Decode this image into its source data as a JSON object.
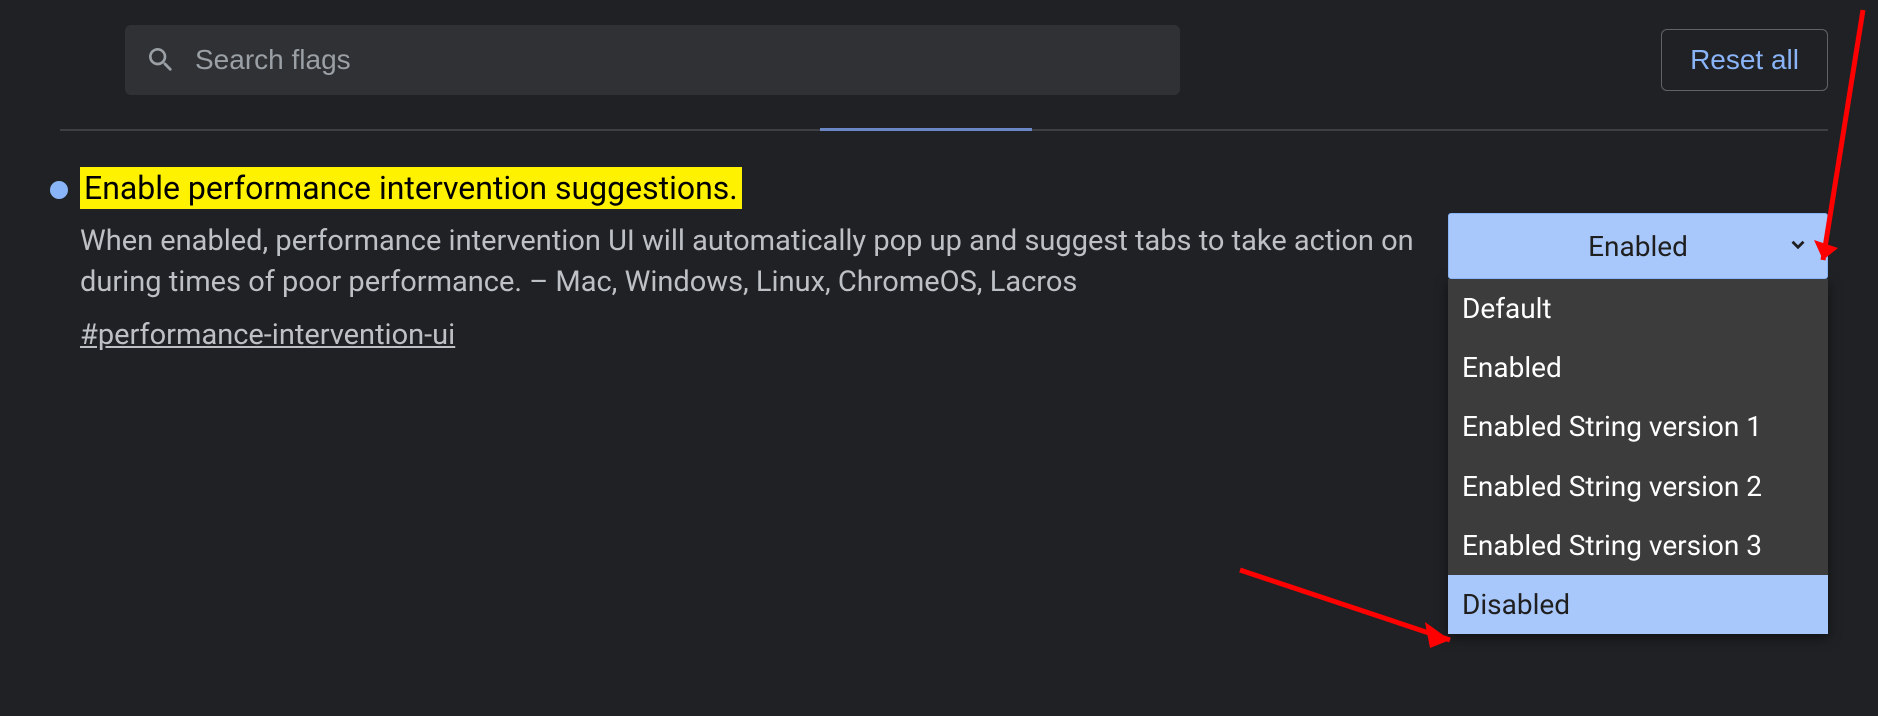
{
  "search": {
    "placeholder": "Search flags"
  },
  "reset_button": {
    "label": "Reset all"
  },
  "flag": {
    "title": "Enable performance intervention suggestions.",
    "description": "When enabled, performance intervention UI will automatically pop up and suggest tabs to take action on during times of poor performance. – Mac, Windows, Linux, ChromeOS, Lacros",
    "id": "#performance-intervention-ui",
    "select": {
      "selected": "Enabled",
      "options": [
        "Default",
        "Enabled",
        "Enabled String version 1",
        "Enabled String version 2",
        "Enabled String version 3",
        "Disabled"
      ],
      "highlighted_index": 5
    }
  },
  "colors": {
    "highlight": "#fff200",
    "accent": "#8ab4f8",
    "select_bg": "#a8c7fa",
    "annotation_arrow": "#ff0000"
  }
}
